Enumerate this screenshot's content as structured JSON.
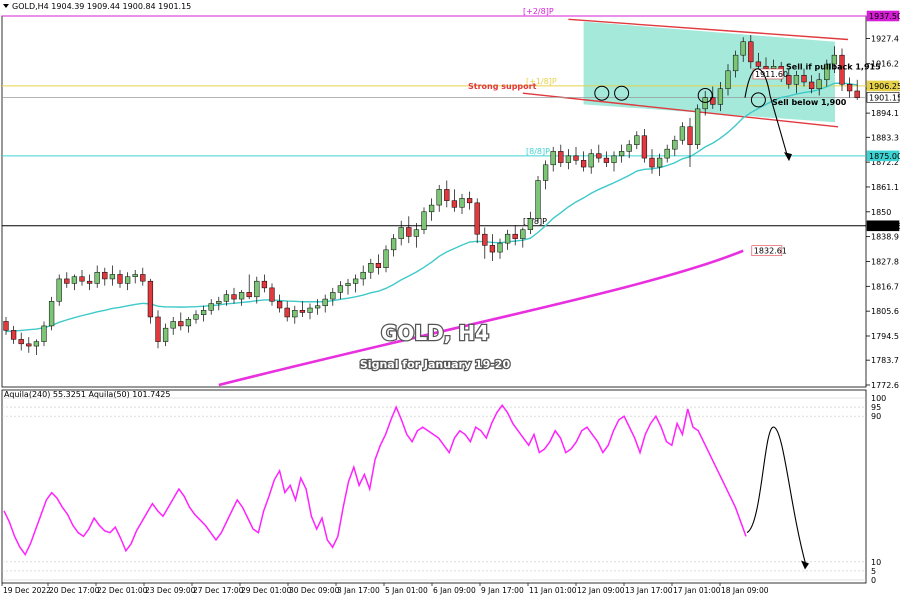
{
  "header": {
    "symbol_info": "GOLD,H4  1904.39 1909.44 1900.84 1901.15",
    "indicator_info": "Aquila(240) 55.3251  Aquila(50) 101.7425"
  },
  "overlay": {
    "title": "GOLD, H4",
    "subtitle": "Signal for January 19-20"
  },
  "colors": {
    "bull": "#7cc576",
    "bear": "#e0393e",
    "ma_fast": "#3fc9c9",
    "ma_slow": "#e830e0",
    "channel_fill": "#7fe0cc",
    "channel_line": "#e0393e",
    "pink_level": "#d41fd4",
    "yellow_level": "#e6d24a",
    "cyan_level": "#3fd3d3",
    "oscillator": "#ff22ff"
  },
  "levels": [
    {
      "name": "plus-2-8",
      "label": "[+2/8]P",
      "value": 1937.5,
      "price_tag": "1937.50",
      "color": "#d41fd4",
      "tag_bg": "#d41fd4",
      "tag_fg": "#ffffff"
    },
    {
      "name": "plus-1-8",
      "label": "[+1/8]P",
      "value": 1906.25,
      "price_tag": "1906.25",
      "color": "#e6d24a",
      "tag_bg": "#e6d24a",
      "tag_fg": "#ffffff"
    },
    {
      "name": "8-8",
      "label": "[8/8]P",
      "value": 1875.0,
      "price_tag": "1875.00",
      "color": "#3fd3d3",
      "tag_bg": "#3fd3d3",
      "tag_fg": "#ffffff"
    },
    {
      "name": "7-8",
      "label": "[7/8]P",
      "value": 1843.75,
      "price_tag": "1843.75",
      "color": "#000000",
      "tag_bg": "#000000",
      "tag_fg": "#ffffff"
    },
    {
      "name": "current",
      "label": "",
      "value": 1901.15,
      "price_tag": "1901.15",
      "color": "#9a9a9a",
      "tag_bg": "#ffffff",
      "tag_fg": "#000000"
    }
  ],
  "annotations": {
    "strong_support": "Strong support",
    "sell_pullback": "Sell if pullback 1,915",
    "sell_below": "Sell below 1,900",
    "tag_1911": "1911.60",
    "tag_1832": "1832.61"
  },
  "chart_data": [
    {
      "type": "candlestick",
      "title": "GOLD, H4",
      "subtitle": "Signal for January 19-20",
      "ylim": [
        1772.6,
        1937.5
      ],
      "y_ticks": [
        1927.4,
        1916.2,
        1905.25,
        1894.1,
        1883.3,
        1872.2,
        1861.1,
        1850.0,
        1838.9,
        1827.8,
        1816.7,
        1805.6,
        1794.5,
        1783.7,
        1772.6
      ],
      "x_tick_labels": [
        "19 Dec 2022",
        "20 Dec 17:00",
        "22 Dec 01:00",
        "23 Dec 09:00",
        "27 Dec 17:00",
        "29 Dec 01:00",
        "30 Dec 09:00",
        "3 Jan 17:00",
        "5 Jan 01:00",
        "6 Jan 09:00",
        "9 Jan 17:00",
        "11 Jan 01:00",
        "12 Jan 09:00",
        "13 Jan 17:00",
        "17 Jan 01:00",
        "18 Jan 09:00"
      ],
      "ohlc": [
        [
          1801,
          1803,
          1795,
          1797
        ],
        [
          1797,
          1799,
          1791,
          1793
        ],
        [
          1793,
          1796,
          1788,
          1791
        ],
        [
          1791,
          1794,
          1787,
          1790
        ],
        [
          1790,
          1793,
          1786,
          1792
        ],
        [
          1792,
          1801,
          1790,
          1799
        ],
        [
          1799,
          1812,
          1797,
          1810
        ],
        [
          1810,
          1822,
          1808,
          1820
        ],
        [
          1820,
          1823,
          1816,
          1818
        ],
        [
          1818,
          1822,
          1815,
          1821
        ],
        [
          1821,
          1824,
          1817,
          1819
        ],
        [
          1819,
          1822,
          1815,
          1818
        ],
        [
          1818,
          1826,
          1816,
          1823
        ],
        [
          1823,
          1825,
          1817,
          1820
        ],
        [
          1820,
          1826,
          1817,
          1822
        ],
        [
          1822,
          1824,
          1816,
          1818
        ],
        [
          1818,
          1823,
          1815,
          1821
        ],
        [
          1821,
          1824,
          1818,
          1822
        ],
        [
          1822,
          1825,
          1817,
          1819
        ],
        [
          1819,
          1820,
          1800,
          1803
        ],
        [
          1803,
          1806,
          1789,
          1792
        ],
        [
          1792,
          1800,
          1790,
          1798
        ],
        [
          1798,
          1803,
          1795,
          1801
        ],
        [
          1801,
          1805,
          1797,
          1799
        ],
        [
          1799,
          1803,
          1796,
          1802
        ],
        [
          1802,
          1806,
          1800,
          1804
        ],
        [
          1804,
          1808,
          1801,
          1806
        ],
        [
          1806,
          1811,
          1804,
          1809
        ],
        [
          1809,
          1812,
          1806,
          1810
        ],
        [
          1810,
          1815,
          1808,
          1813
        ],
        [
          1813,
          1816,
          1809,
          1811
        ],
        [
          1811,
          1815,
          1808,
          1814
        ],
        [
          1814,
          1822,
          1811,
          1812
        ],
        [
          1812,
          1821,
          1809,
          1819
        ],
        [
          1819,
          1822,
          1814,
          1816
        ],
        [
          1816,
          1818,
          1808,
          1810
        ],
        [
          1810,
          1813,
          1805,
          1807
        ],
        [
          1807,
          1810,
          1801,
          1803
        ],
        [
          1803,
          1808,
          1800,
          1806
        ],
        [
          1806,
          1810,
          1803,
          1805
        ],
        [
          1805,
          1809,
          1802,
          1807
        ],
        [
          1807,
          1811,
          1804,
          1808
        ],
        [
          1808,
          1813,
          1805,
          1811
        ],
        [
          1811,
          1816,
          1808,
          1814
        ],
        [
          1814,
          1819,
          1811,
          1817
        ],
        [
          1817,
          1820,
          1813,
          1818
        ],
        [
          1818,
          1822,
          1814,
          1820
        ],
        [
          1820,
          1826,
          1817,
          1823
        ],
        [
          1823,
          1829,
          1820,
          1827
        ],
        [
          1827,
          1831,
          1822,
          1825
        ],
        [
          1825,
          1835,
          1823,
          1833
        ],
        [
          1833,
          1840,
          1830,
          1838
        ],
        [
          1838,
          1846,
          1835,
          1843
        ],
        [
          1843,
          1848,
          1836,
          1839
        ],
        [
          1839,
          1845,
          1834,
          1842
        ],
        [
          1842,
          1852,
          1840,
          1850
        ],
        [
          1850,
          1856,
          1846,
          1853
        ],
        [
          1853,
          1862,
          1850,
          1860
        ],
        [
          1860,
          1864,
          1852,
          1855
        ],
        [
          1855,
          1860,
          1850,
          1852
        ],
        [
          1852,
          1858,
          1849,
          1856
        ],
        [
          1856,
          1859,
          1851,
          1854
        ],
        [
          1854,
          1856,
          1836,
          1840
        ],
        [
          1840,
          1843,
          1829,
          1835
        ],
        [
          1835,
          1840,
          1828,
          1832
        ],
        [
          1832,
          1838,
          1829,
          1836
        ],
        [
          1836,
          1842,
          1833,
          1840
        ],
        [
          1840,
          1844,
          1835,
          1838
        ],
        [
          1838,
          1843,
          1834,
          1842
        ],
        [
          1842,
          1850,
          1840,
          1847
        ],
        [
          1847,
          1866,
          1845,
          1864
        ],
        [
          1864,
          1873,
          1860,
          1871
        ],
        [
          1871,
          1879,
          1868,
          1877
        ],
        [
          1877,
          1880,
          1870,
          1872
        ],
        [
          1872,
          1878,
          1869,
          1875
        ],
        [
          1875,
          1879,
          1871,
          1873
        ],
        [
          1873,
          1877,
          1868,
          1870
        ],
        [
          1870,
          1878,
          1867,
          1876
        ],
        [
          1876,
          1880,
          1872,
          1874
        ],
        [
          1874,
          1877,
          1870,
          1872
        ],
        [
          1872,
          1877,
          1868,
          1875
        ],
        [
          1875,
          1880,
          1872,
          1877
        ],
        [
          1877,
          1882,
          1874,
          1880
        ],
        [
          1880,
          1886,
          1878,
          1884
        ],
        [
          1884,
          1887,
          1872,
          1874
        ],
        [
          1874,
          1878,
          1867,
          1870
        ],
        [
          1870,
          1876,
          1866,
          1874
        ],
        [
          1874,
          1880,
          1872,
          1878
        ],
        [
          1878,
          1884,
          1875,
          1882
        ],
        [
          1882,
          1890,
          1880,
          1888
        ],
        [
          1888,
          1892,
          1870,
          1880
        ],
        [
          1880,
          1898,
          1878,
          1896
        ],
        [
          1896,
          1904,
          1893,
          1901
        ],
        [
          1901,
          1906,
          1896,
          1898
        ],
        [
          1898,
          1908,
          1895,
          1905
        ],
        [
          1905,
          1916,
          1902,
          1913
        ],
        [
          1913,
          1922,
          1910,
          1920
        ],
        [
          1920,
          1928,
          1917,
          1926
        ],
        [
          1926,
          1929,
          1914,
          1917
        ],
        [
          1917,
          1921,
          1912,
          1915
        ],
        [
          1915,
          1919,
          1911,
          1914
        ],
        [
          1914,
          1918,
          1910,
          1915
        ],
        [
          1915,
          1917,
          1908,
          1911
        ],
        [
          1911,
          1914,
          1905,
          1907
        ],
        [
          1907,
          1913,
          1903,
          1911
        ],
        [
          1911,
          1914,
          1906,
          1908
        ],
        [
          1908,
          1911,
          1903,
          1905
        ],
        [
          1905,
          1912,
          1902,
          1909
        ],
        [
          1909,
          1918,
          1906,
          1916
        ],
        [
          1916,
          1924,
          1912,
          1920
        ],
        [
          1920,
          1923,
          1904,
          1907
        ],
        [
          1907,
          1910,
          1901,
          1904
        ],
        [
          1904,
          1909,
          1900,
          1901
        ]
      ],
      "series": [
        {
          "type": "line",
          "values": [
            1796.5,
            1796.7,
            1797.0,
            1797.3,
            1797.6,
            1798.2,
            1799.2,
            1800.6,
            1801.7,
            1802.7,
            1803.6,
            1804.4,
            1805.3,
            1806.0,
            1806.8,
            1807.3,
            1808.0,
            1808.6,
            1809.1,
            1808.8,
            1807.8,
            1807.5,
            1807.5,
            1807.4,
            1807.5,
            1807.6,
            1807.8,
            1808.1,
            1808.4,
            1808.9,
            1809.1,
            1809.5,
            1809.8,
            1810.3,
            1810.6,
            1810.6,
            1810.4,
            1810.1,
            1810.0,
            1809.8,
            1809.8,
            1809.8,
            1809.9,
            1810.3,
            1810.9,
            1811.4,
            1812.0,
            1812.8,
            1813.8,
            1814.5,
            1815.8,
            1817.5,
            1819.6,
            1821.3,
            1823.1,
            1825.2,
            1827.5,
            1830.1,
            1832.1,
            1833.6,
            1835.1,
            1836.5,
            1836.8,
            1836.6,
            1836.3,
            1836.2,
            1836.6,
            1836.9,
            1837.3,
            1838.2,
            1840.8,
            1843.8,
            1847.1,
            1849.6,
            1852.2,
            1854.4,
            1856.2,
            1858.3,
            1860.0,
            1861.5,
            1863.0,
            1864.6,
            1866.3,
            1868.2,
            1869.0,
            1869.2,
            1869.7,
            1870.7,
            1871.9,
            1873.7,
            1874.6,
            1876.7,
            1879.0,
            1880.7,
            1882.9,
            1885.5,
            1888.6,
            1892.0,
            1894.3,
            1896.2,
            1898.0,
            1899.8,
            1901.1,
            1901.7,
            1902.6,
            1903.3,
            1903.8,
            1904.6,
            1905.9,
            1907.4,
            1907.5,
            1907.2,
            1906.7
          ]
        },
        {
          "type": "line",
          "values": [
            1772.6,
            1832.6
          ]
        },
        {
          "type": "line",
          "values": [
            55.3,
            101.7
          ]
        }
      ]
    },
    {
      "type": "line",
      "title": "Aquila(240) 55.3251  Aquila(50) 101.7425",
      "ylim": [
        0,
        100
      ],
      "y_ticks": [
        100,
        95,
        90,
        10,
        5,
        0
      ],
      "values": [
        38,
        32,
        24,
        18,
        14,
        20,
        28,
        36,
        44,
        48,
        45,
        40,
        36,
        30,
        26,
        24,
        28,
        34,
        30,
        27,
        26,
        29,
        23,
        16,
        20,
        27,
        32,
        37,
        42,
        38,
        35,
        40,
        45,
        50,
        46,
        40,
        36,
        33,
        30,
        26,
        22,
        26,
        32,
        38,
        44,
        40,
        34,
        28,
        26,
        38,
        46,
        55,
        60,
        48,
        52,
        44,
        56,
        50,
        35,
        28,
        34,
        22,
        18,
        24,
        40,
        54,
        62,
        52,
        58,
        50,
        66,
        74,
        80,
        88,
        95,
        88,
        80,
        76,
        82,
        84,
        82,
        80,
        78,
        74,
        70,
        78,
        82,
        80,
        76,
        84,
        82,
        78,
        86,
        92,
        96,
        92,
        86,
        82,
        78,
        74,
        80,
        70,
        72,
        76,
        82,
        78,
        70,
        72,
        76,
        82,
        84,
        80,
        76,
        70,
        74,
        82,
        88,
        90,
        84,
        78,
        70,
        80,
        86,
        90,
        84,
        76,
        74,
        86,
        80,
        94,
        84,
        82,
        76,
        70,
        64,
        58,
        52,
        46,
        40,
        32,
        24
      ]
    }
  ]
}
